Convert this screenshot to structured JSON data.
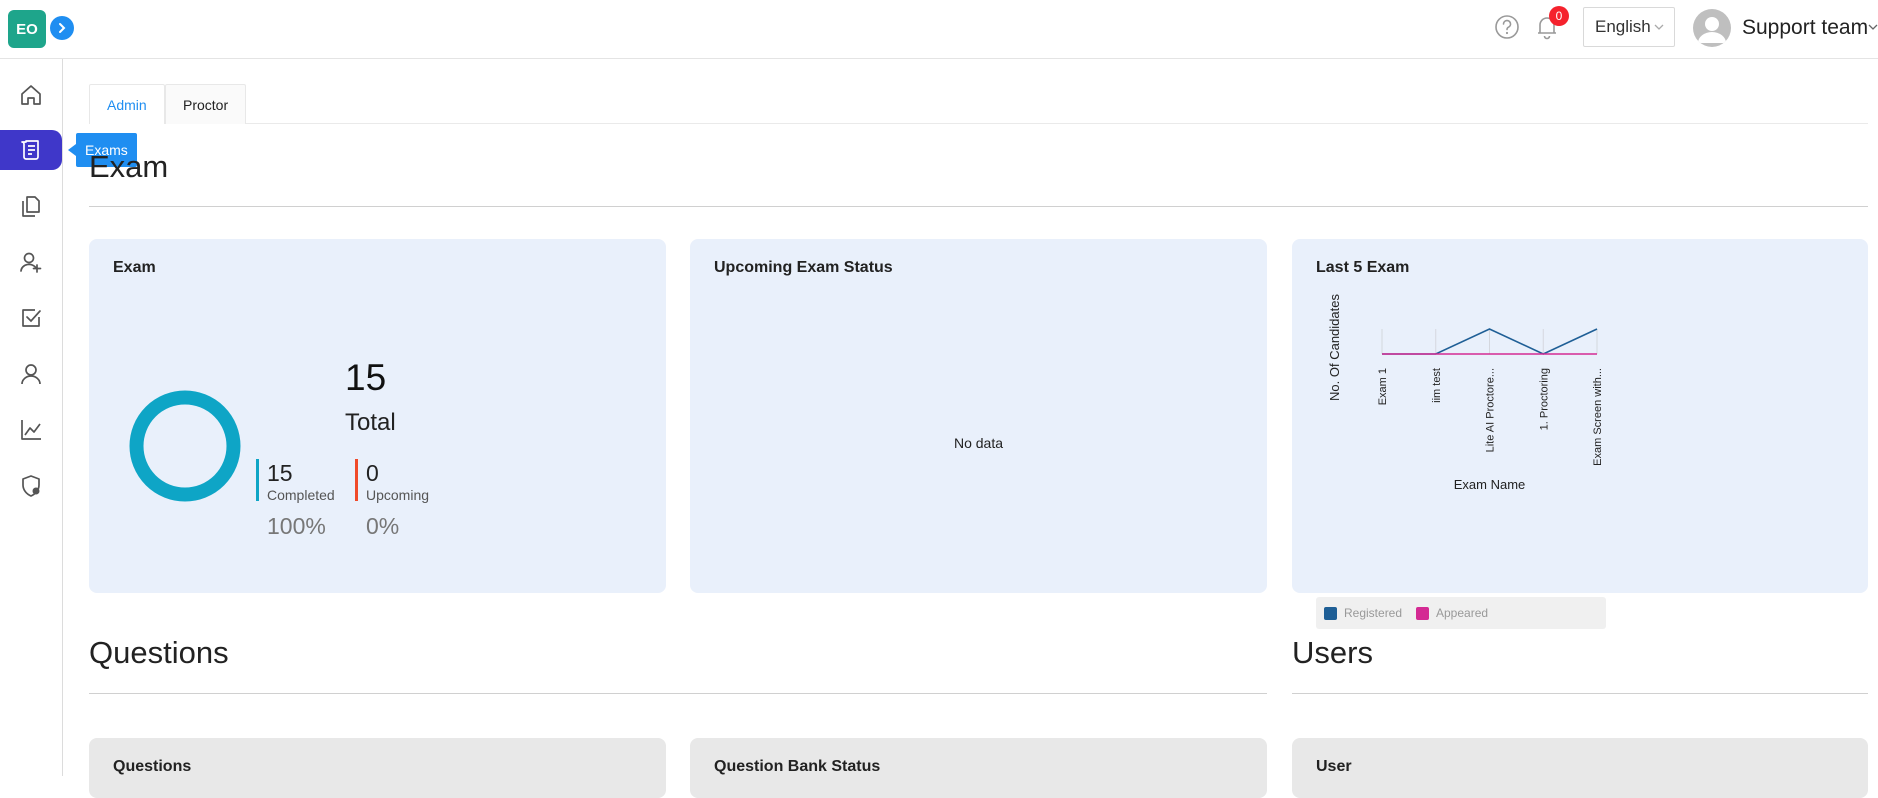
{
  "header": {
    "logo_text": "EO",
    "notifications_count": "0",
    "language": "English",
    "user_name": "Support team"
  },
  "sidebar": {
    "tooltip": "Exams",
    "items": [
      {
        "name": "home",
        "icon": "home-icon"
      },
      {
        "name": "exams",
        "icon": "scroll-icon",
        "active": true
      },
      {
        "name": "question-banks",
        "icon": "documents-icon"
      },
      {
        "name": "add-user",
        "icon": "user-plus-icon"
      },
      {
        "name": "tasks",
        "icon": "checkbox-icon"
      },
      {
        "name": "users",
        "icon": "user-icon"
      },
      {
        "name": "reports",
        "icon": "chart-icon"
      },
      {
        "name": "security",
        "icon": "shield-settings-icon"
      }
    ]
  },
  "tabs": [
    {
      "label": "Admin",
      "active": true
    },
    {
      "label": "Proctor",
      "active": false
    }
  ],
  "sections": {
    "exam_title": "Exam",
    "questions_title": "Questions",
    "users_title": "Users"
  },
  "exam_card": {
    "title": "Exam",
    "total": "15",
    "total_label": "Total",
    "completed": "15",
    "completed_label": "Completed",
    "completed_pct": "100%",
    "upcoming": "0",
    "upcoming_label": "Upcoming",
    "upcoming_pct": "0%",
    "colors": {
      "completed": "#0ea5c6",
      "upcoming": "#f04a2a"
    }
  },
  "upcoming_card": {
    "title": "Upcoming Exam Status",
    "empty_text": "No data"
  },
  "last5_card": {
    "title": "Last 5 Exam"
  },
  "bottom_cards": {
    "questions": "Questions",
    "question_bank_status": "Question Bank Status",
    "user": "User"
  },
  "chart_data": {
    "type": "line",
    "categories": [
      "Exam 1",
      "iim test",
      "Lite AI Proctore...",
      "1. Proctoring",
      "Exam Screen with..."
    ],
    "series": [
      {
        "name": "Registered",
        "values": [
          0,
          0,
          1,
          0,
          1
        ],
        "color": "#1f5f96"
      },
      {
        "name": "Appeared",
        "values": [
          0,
          0,
          0,
          0,
          0
        ],
        "color": "#d42a93"
      }
    ],
    "xlabel": "Exam Name",
    "ylabel": "No. Of Candidates",
    "ylim": [
      0,
      1
    ],
    "grid": true,
    "legend": "bottom"
  }
}
